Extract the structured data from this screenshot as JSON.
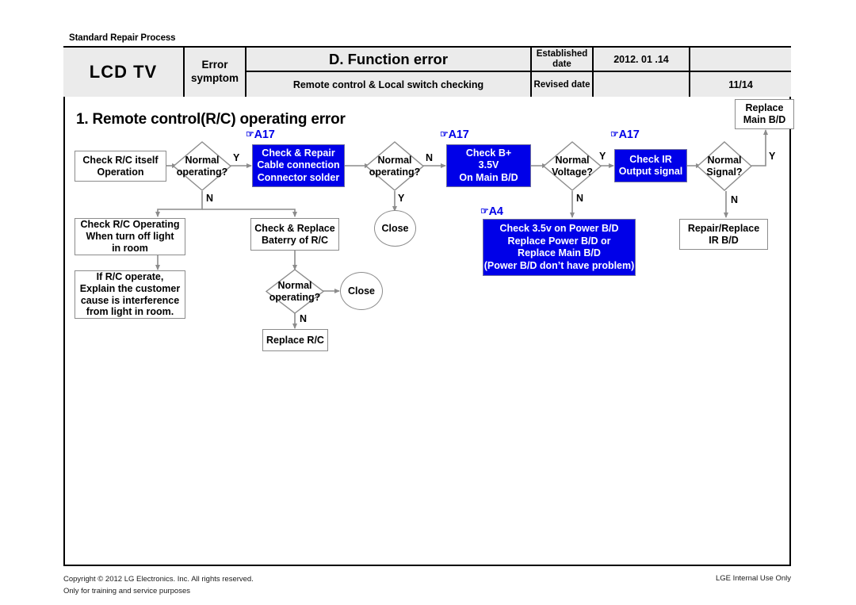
{
  "header": {
    "banner": "Standard Repair Process",
    "product": "LCD  TV",
    "error_symptom_label": "Error\nsymptom",
    "error_symptom_line1": "Error",
    "error_symptom_line2": "symptom",
    "function_error": "D. Function error",
    "subtitle": "Remote control & Local switch checking",
    "established_label_line1": "Established",
    "established_label_line2": "date",
    "established_value": "2012. 01 .14",
    "revised_label": "Revised date",
    "revised_value": "",
    "page_number": "11/14"
  },
  "section": {
    "title": "1. Remote control(R/C) operating error"
  },
  "flow": {
    "nodes": {
      "check_rc_itself": "Check R/C itself\nOperation",
      "check_rc_itself_l1": "Check R/C itself",
      "check_rc_itself_l2": "Operation",
      "d1": "Normal\noperating?",
      "d1_l1": "Normal",
      "d1_l2": "operating?",
      "check_repair_cable_l1": "Check & Repair",
      "check_repair_cable_l2": "Cable connection",
      "check_repair_cable_l3": "Connector solder",
      "d2_l1": "Normal",
      "d2_l2": "operating?",
      "close1": "Close",
      "check_b_plus_l1": "Check B+",
      "check_b_plus_l2": "3.5V",
      "check_b_plus_l3": "On Main B/D",
      "d3_l1": "Normal",
      "d3_l2": "Voltage?",
      "check_ir_l1": "Check IR",
      "check_ir_l2": "Output signal",
      "d4_l1": "Normal",
      "d4_l2": "Signal?",
      "replace_main_bd_l1": "Replace",
      "replace_main_bd_l2": "Main B/D",
      "repair_replace_ir_l1": "Repair/Replace",
      "repair_replace_ir_l2": "IR B/D",
      "power_bd_l1": "Check 3.5v on Power B/D",
      "power_bd_l2": "Replace Power B/D or",
      "power_bd_l3": "Replace Main B/D",
      "power_bd_l4": "(Power B/D don’t have problem)",
      "check_rc_light_l1": "Check R/C Operating",
      "check_rc_light_l2": "When turn off light",
      "check_rc_light_l3": "in room",
      "explain_l1": "If R/C operate,",
      "explain_l2": "Explain the customer",
      "explain_l3": "cause is interference",
      "explain_l4": "from light in room.",
      "check_replace_battery_l1": "Check & Replace",
      "check_replace_battery_l2": "Baterry of R/C",
      "d5_l1": "Normal",
      "d5_l2": "operating?",
      "close2": "Close",
      "replace_rc": "Replace R/C"
    },
    "ref_tags": {
      "tag_a17_1": "A17",
      "tag_a17_2": "A17",
      "tag_a17_3": "A17",
      "tag_a4": "A4",
      "hand_icon": "☞"
    },
    "edge_labels": {
      "y1": "Y",
      "n1": "N",
      "n2": "N",
      "y2": "Y",
      "y3": "Y",
      "n3": "N",
      "y4": "Y",
      "n4": "N",
      "n5": "N"
    }
  },
  "footer": {
    "copyright_line1": "Copyright © 2012 LG Electronics. Inc. All rights reserved.",
    "copyright_line2": "Only for training and service purposes",
    "internal": "LGE Internal Use Only"
  },
  "colors": {
    "accent_blue": "#0000e8",
    "header_gray": "#ebebeb",
    "line_gray": "#8c8c8c"
  }
}
